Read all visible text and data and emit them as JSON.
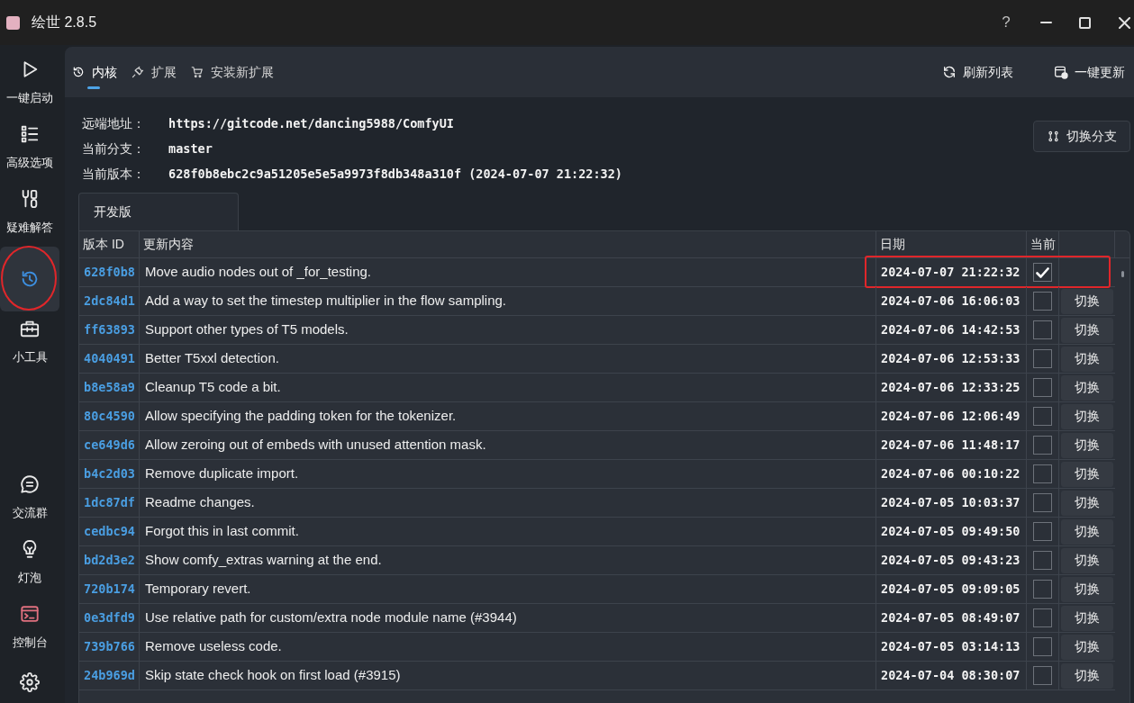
{
  "window": {
    "title": "绘世 2.8.5",
    "help": "?"
  },
  "sidebar": {
    "top_items": [
      {
        "label": "一键启动",
        "selected": false,
        "annotated": false
      },
      {
        "label": "高级选项",
        "selected": false,
        "annotated": false
      },
      {
        "label": "疑难解答",
        "selected": false,
        "annotated": false
      },
      {
        "selected": true,
        "annotated": true
      },
      {
        "label": "小工具",
        "selected": false,
        "annotated": false
      }
    ],
    "bottom_items": [
      {
        "label": "交流群",
        "selected": false
      },
      {
        "label": "灯泡",
        "selected": false
      },
      {
        "label": "控制台",
        "selected": false
      },
      {
        "selected": false
      }
    ]
  },
  "toolbar": {
    "tabs": [
      {
        "label": "内核",
        "selected": true
      },
      {
        "label": "扩展",
        "selected": false
      },
      {
        "label": "安装新扩展",
        "selected": false
      }
    ],
    "actions": [
      "刷新列表",
      "一键更新"
    ]
  },
  "repo_info": {
    "fields": [
      {
        "label": "远端地址：",
        "value": "https://gitcode.net/dancing5988/ComfyUI"
      },
      {
        "label": "当前分支：",
        "value": "master"
      },
      {
        "label": "当前版本：",
        "value": "628f0b8ebc2c9a51205e5e5a9973f8db348a310f (2024-07-07 21:22:32)"
      }
    ],
    "switch_branch_button": "切换分支"
  },
  "version_tabs": [
    {
      "label": "开发版",
      "selected": true
    }
  ],
  "table": {
    "columns": [
      "版本 ID",
      "更新内容",
      "日期",
      "当前"
    ],
    "rows": [
      {
        "id": "628f0b8",
        "message": "Move audio nodes out of _for_testing.",
        "date": "2024-07-07 21:22:32",
        "current": true,
        "annotated": true
      },
      {
        "id": "2dc84d1",
        "message": "Add a way to set the timestep multiplier in the flow sampling.",
        "date": "2024-07-06 16:06:03",
        "current": false,
        "annotated": false,
        "action": "切换"
      },
      {
        "id": "ff63893",
        "message": "Support other types of T5 models.",
        "date": "2024-07-06 14:42:53",
        "current": false,
        "annotated": false,
        "action": "切换"
      },
      {
        "id": "4040491",
        "message": "Better T5xxl detection.",
        "date": "2024-07-06 12:53:33",
        "current": false,
        "annotated": false,
        "action": "切换"
      },
      {
        "id": "b8e58a9",
        "message": "Cleanup T5 code a bit.",
        "date": "2024-07-06 12:33:25",
        "current": false,
        "annotated": false,
        "action": "切换"
      },
      {
        "id": "80c4590",
        "message": "Allow specifying the padding token for the tokenizer.",
        "date": "2024-07-06 12:06:49",
        "current": false,
        "annotated": false,
        "action": "切换"
      },
      {
        "id": "ce649d6",
        "message": "Allow zeroing out of embeds with unused attention mask.",
        "date": "2024-07-06 11:48:17",
        "current": false,
        "annotated": false,
        "action": "切换"
      },
      {
        "id": "b4c2d03",
        "message": "Remove duplicate import.",
        "date": "2024-07-06 00:10:22",
        "current": false,
        "annotated": false,
        "action": "切换"
      },
      {
        "id": "1dc87df",
        "message": "Readme changes.",
        "date": "2024-07-05 10:03:37",
        "current": false,
        "annotated": false,
        "action": "切换"
      },
      {
        "id": "cedbc94",
        "message": "Forgot this in last commit.",
        "date": "2024-07-05 09:49:50",
        "current": false,
        "annotated": false,
        "action": "切换"
      },
      {
        "id": "bd2d3e2",
        "message": "Show comfy_extras warning at the end.",
        "date": "2024-07-05 09:43:23",
        "current": false,
        "annotated": false,
        "action": "切换"
      },
      {
        "id": "720b174",
        "message": "Temporary revert.",
        "date": "2024-07-05 09:09:05",
        "current": false,
        "annotated": false,
        "action": "切换"
      },
      {
        "id": "0e3dfd9",
        "message": "Use relative path for custom/extra node module name (#3944)",
        "date": "2024-07-05 08:49:07",
        "current": false,
        "annotated": false,
        "action": "切换"
      },
      {
        "id": "739b766",
        "message": "Remove useless code.",
        "date": "2024-07-05 03:14:13",
        "current": false,
        "annotated": false,
        "action": "切换"
      },
      {
        "id": "24b969d",
        "message": "Skip state check hook on first load (#3915)",
        "date": "2024-07-04 08:30:07",
        "current": false,
        "annotated": false,
        "action": "切换"
      }
    ]
  }
}
